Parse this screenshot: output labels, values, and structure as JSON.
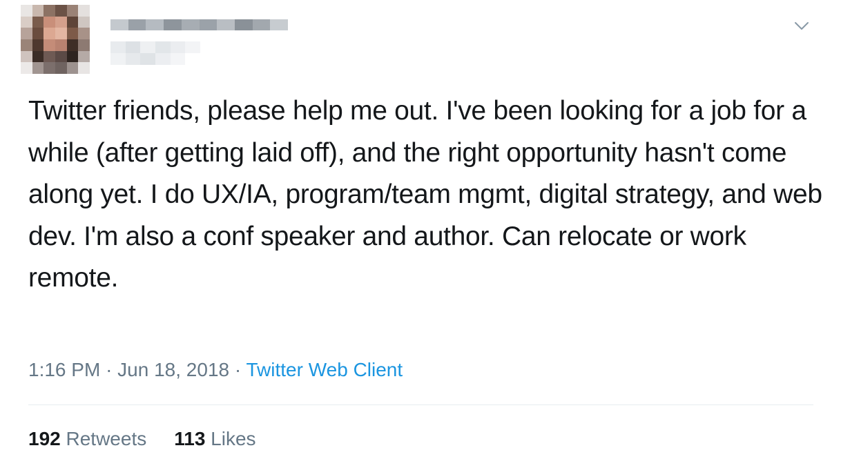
{
  "tweet": {
    "text": "Twitter friends, please help me out. I've been looking for a job for a while (after getting laid off), and the right opportunity hasn't come along yet. I do UX/IA, program/team mgmt, digital strategy, and web dev. I'm also a conf speaker and author. Can relocate or work remote.",
    "time": "1:16 PM",
    "separator": "·",
    "date": "Jun 18, 2018",
    "source": "Twitter Web Client",
    "retweets_count": "192",
    "retweets_label": "Retweets",
    "likes_count": "113",
    "likes_label": "Likes"
  },
  "icons": {
    "menu": "chevron-down-icon"
  },
  "colors": {
    "text": "#14171a",
    "meta": "#657786",
    "link": "#1b95e0",
    "divider": "#e6ecf0"
  }
}
